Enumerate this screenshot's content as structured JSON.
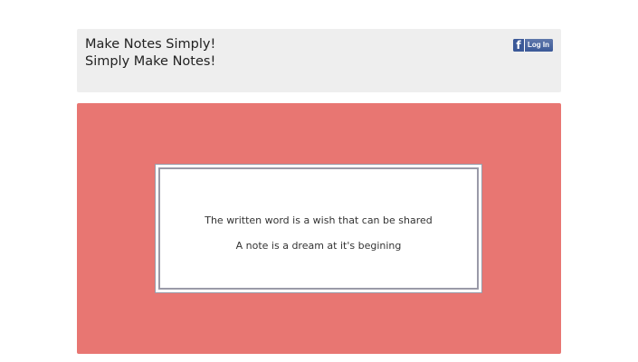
{
  "header": {
    "tagline_line1": "Make Notes Simply!",
    "tagline_line2": "Simply Make Notes!",
    "facebook_login": {
      "icon_glyph": "f",
      "label": "Log In",
      "icon": "facebook-icon"
    },
    "background_color": "#eeeeee"
  },
  "main": {
    "background_color": "#e87672",
    "note": {
      "line1": "The written word is a wish that can be shared",
      "line2": "A note is a dream at it's begining"
    }
  }
}
